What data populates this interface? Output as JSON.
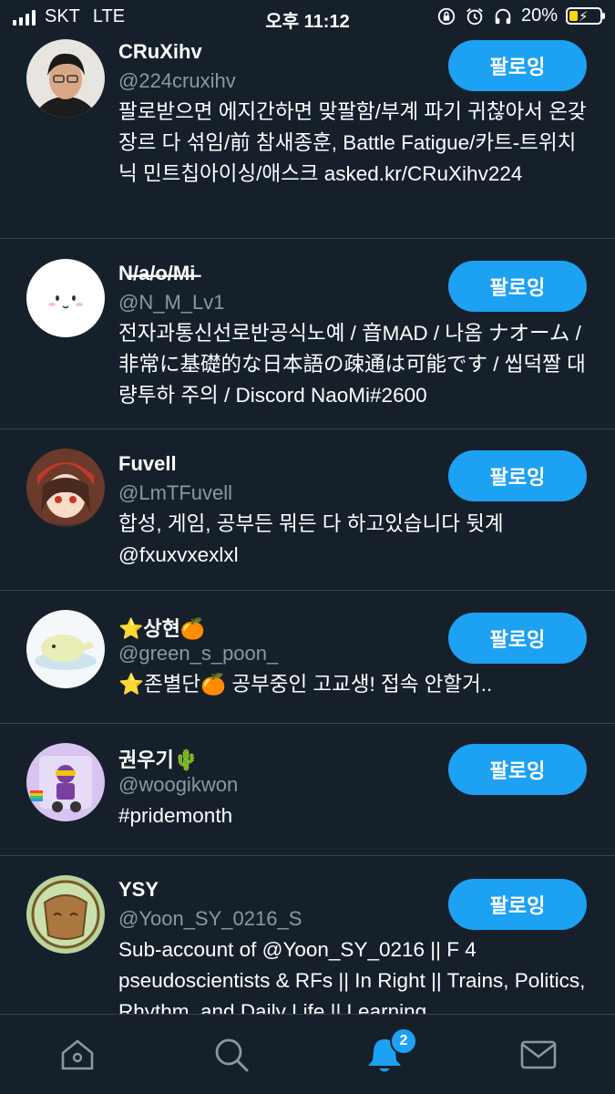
{
  "status_bar": {
    "carrier": "SKT",
    "network": "LTE",
    "time": "오후 11:12",
    "battery_percent": "20%"
  },
  "follow_label": "팔로잉",
  "users": [
    {
      "name": "CRuXihv",
      "handle": "@224cruxihv",
      "bio": "팔로받으면 에지간하면 맞팔함/부계 파기 귀찮아서 온갖 장르 다 섞임/前 참새종훈, Battle Fatigue/카트-트위치닉 민트칩아이싱/애스크 asked.kr/CRuXihv224"
    },
    {
      "name": "N̶/̶a̶/̶o̶/̶M̶i̶",
      "handle": "@N_M_Lv1",
      "bio": "전자과통신선로반공식노예 / 音MAD / 나옴 ナオーム / 非常に基礎的な日本語の疎通は可能です / 씹덕짤 대량투하 주의 / Discord NaoMi#2600"
    },
    {
      "name": "Fuvell",
      "handle": "@LmTFuvell",
      "bio": "합성, 게임, 공부든 뭐든 다 하고있습니다 뒷계 @fxuxvxexlxl"
    },
    {
      "name": "⭐상현🍊",
      "handle": "@green_s_poon_",
      "bio": "⭐존별단🍊 공부중인 고교생! 접속 안할거.."
    },
    {
      "name": "권우기🌵",
      "handle": "@woogikwon",
      "bio": "#pridemonth"
    },
    {
      "name": "YSY",
      "handle": "@Yoon_SY_0216_S",
      "bio": "Sub-account of @Yoon_SY_0216 || F 4 pseudoscientists & RFs || In Right || Trains, Politics, Rhythm, and Daily Life || Learning"
    }
  ],
  "tabbar": {
    "notification_count": "2",
    "icons": [
      "home-icon",
      "search-icon",
      "bell-icon",
      "mail-icon"
    ]
  },
  "colors": {
    "background": "#15202b",
    "accent": "#1da1f2",
    "secondary_text": "#8899a6",
    "divider": "#38444d"
  }
}
